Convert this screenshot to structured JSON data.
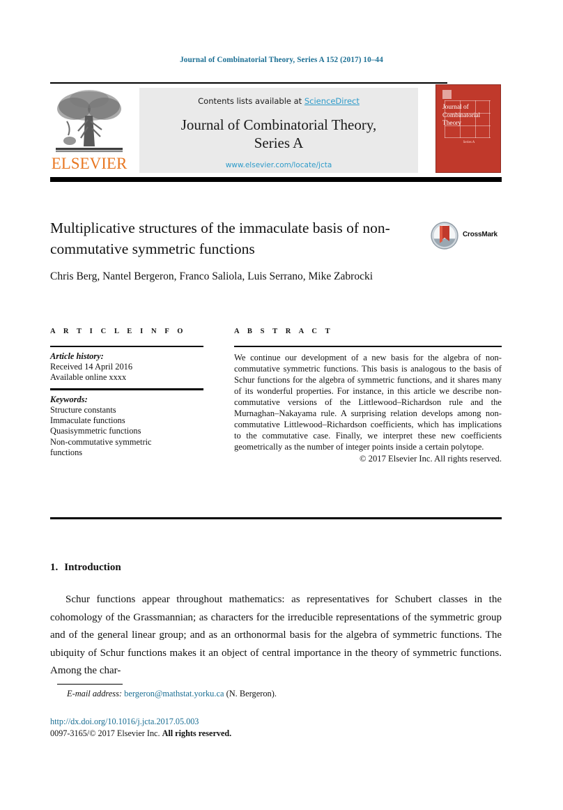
{
  "running_head": "Journal of Combinatorial Theory, Series A 152 (2017) 10–44",
  "masthead": {
    "contents_prefix": "Contents lists available at ",
    "sciencedirect": "ScienceDirect",
    "journal_name_line1": "Journal of Combinatorial Theory,",
    "journal_name_line2": "Series A",
    "journal_url": "www.elsevier.com/locate/jcta",
    "publisher_wordmark": "ELSEVIER",
    "cover": {
      "title": "Journal of Combinatorial Theory",
      "subtitle": "Series A"
    }
  },
  "article": {
    "title": "Multiplicative structures of the immaculate basis of non-commutative symmetric functions",
    "authors": "Chris Berg, Nantel Bergeron, Franco Saliola, Luis Serrano, Mike Zabrocki",
    "crossmark_label": "CrossMark"
  },
  "info": {
    "heading": "A R T I C L E   I N F O",
    "history_label": "Article history:",
    "history_lines": [
      "Received 14 April 2016",
      "Available online xxxx"
    ],
    "keywords_label": "Keywords:",
    "keywords": [
      "Structure constants",
      "Immaculate functions",
      "Quasisymmetric functions",
      "Non-commutative symmetric",
      "functions"
    ]
  },
  "abstract": {
    "heading": "A B S T R A C T",
    "body": "We continue our development of a new basis for the algebra of non-commutative symmetric functions. This basis is analogous to the basis of Schur functions for the algebra of symmetric functions, and it shares many of its wonderful properties. For instance, in this article we describe non-commutative versions of the Littlewood–Richardson rule and the Murnaghan–Nakayama rule. A surprising relation develops among non-commutative Littlewood–Richardson coefficients, which has implications to the commutative case. Finally, we interpret these new coefficients geometrically as the number of integer points inside a certain polytope.",
    "copyright": "© 2017 Elsevier Inc. All rights reserved."
  },
  "introduction": {
    "number": "1.",
    "heading": "Introduction",
    "paragraph": "Schur functions appear throughout mathematics: as representatives for Schubert classes in the cohomology of the Grassmannian; as characters for the irreducible representations of the symmetric group and of the general linear group; and as an orthonormal basis for the algebra of symmetric functions. The ubiquity of Schur functions makes it an object of central importance in the theory of symmetric functions. Among the char-"
  },
  "footer": {
    "email_label": "E-mail address:",
    "email": "bergeron@mathstat.yorku.ca",
    "email_suffix": "(N. Bergeron).",
    "doi": "http://dx.doi.org/10.1016/j.jcta.2017.05.003",
    "issn_prefix": "0097-3165/© 2017 Elsevier Inc. ",
    "issn_rights": "All rights reserved."
  },
  "colors": {
    "link": "#1a6e93",
    "sciencedirect": "#2e9bc9",
    "elsevier_orange": "#E87722",
    "cover_red": "#c0392b",
    "panel_gray": "#eaeaea"
  }
}
